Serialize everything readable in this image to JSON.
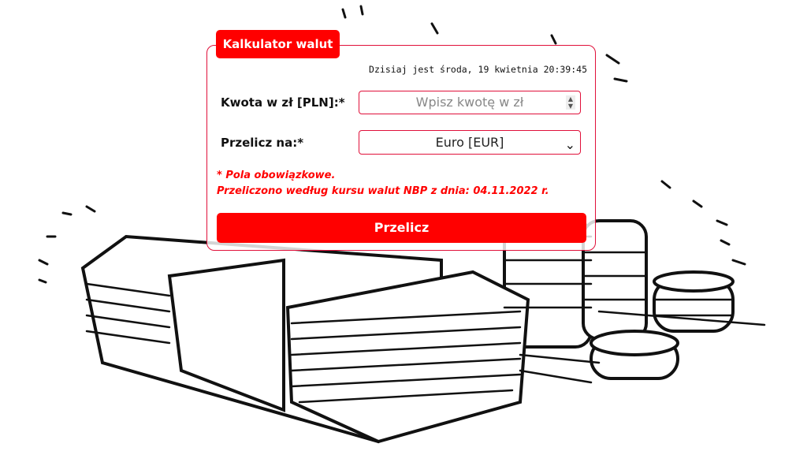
{
  "title": "Kalkulator walut",
  "date_text": "Dzisiaj jest środa, 19 kwietnia 20:39:45",
  "form": {
    "amount_label": "Kwota w zł [PLN]:*",
    "amount_placeholder": "Wpisz kwotę w zł",
    "amount_value": "",
    "currency_label": "Przelicz na:*",
    "currency_selected": "Euro [EUR]"
  },
  "notes": {
    "required": "* Pola obowiązkowe.",
    "rate_info": "Przeliczono według kursu walut NBP z dnia: 04.11.2022 r."
  },
  "submit_label": "Przelicz",
  "colors": {
    "accent": "#ff0000",
    "border": "#e0103a"
  },
  "icons": {
    "spinner": "spinner-arrows-icon",
    "select": "chevron-down-icon"
  }
}
